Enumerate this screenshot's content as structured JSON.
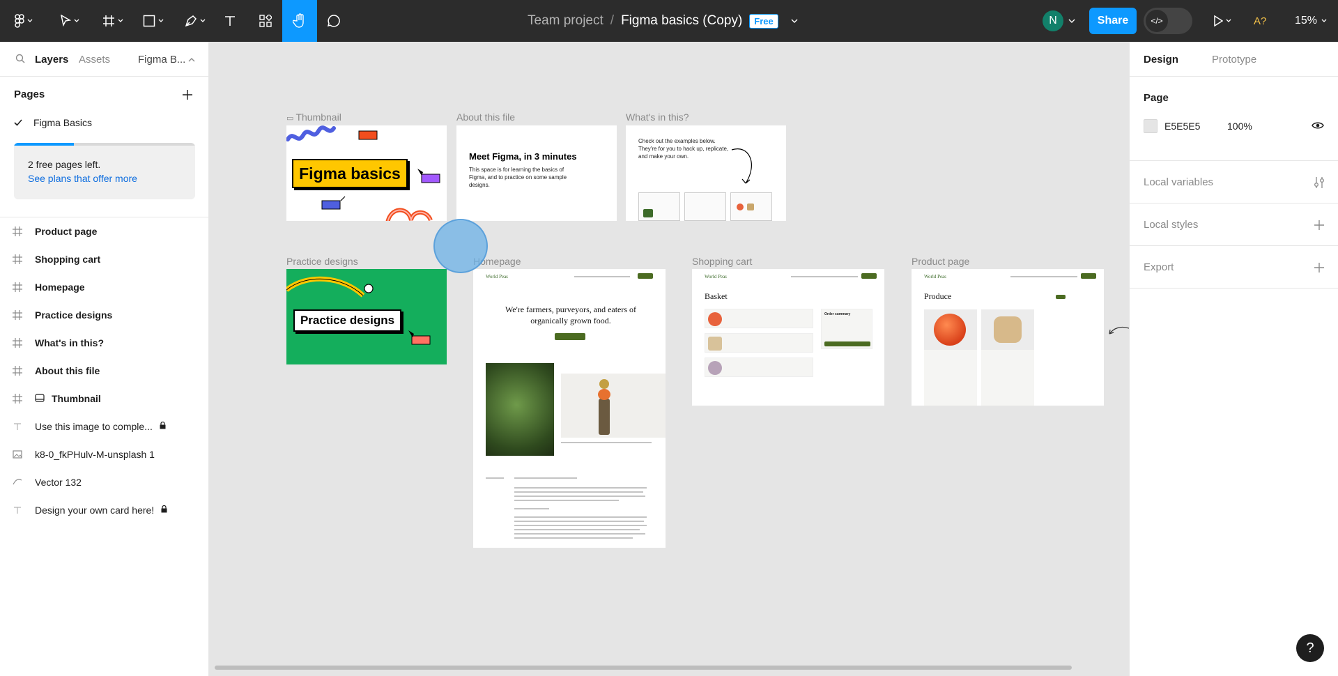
{
  "toolbar": {
    "tools": [
      "figma-menu",
      "move-tool",
      "frame-tool",
      "shape-tool",
      "pen-tool",
      "text-tool",
      "resources-tool",
      "hand-tool",
      "comment-tool"
    ],
    "breadcrumb_team": "Team project",
    "breadcrumb_sep": "/",
    "file_name": "Figma basics (Copy)",
    "plan_badge": "Free",
    "avatar_initial": "N",
    "share_label": "Share",
    "dev_mode_icon": "</>",
    "a_label": "A?",
    "zoom": "15%",
    "colors": {
      "bar": "#2c2c2c",
      "accent": "#0d99ff"
    }
  },
  "left_panel": {
    "tabs": {
      "layers": "Layers",
      "assets": "Assets",
      "file": "Figma B..."
    },
    "pages_header": "Pages",
    "current_page": "Figma Basics",
    "notice": {
      "text": "2 free pages left.",
      "link": "See plans that offer more",
      "progress": 0.33
    },
    "layers": [
      {
        "name": "Product page",
        "icon": "frame-icon"
      },
      {
        "name": "Shopping cart",
        "icon": "frame-icon"
      },
      {
        "name": "Homepage",
        "icon": "frame-icon"
      },
      {
        "name": "Practice designs",
        "icon": "frame-icon"
      },
      {
        "name": "What's in this?",
        "icon": "frame-icon"
      },
      {
        "name": "About this file",
        "icon": "frame-icon"
      },
      {
        "name": "Thumbnail",
        "icon": "frame-icon"
      },
      {
        "name": "Use this image to comple...",
        "icon": "text-icon"
      },
      {
        "name": "k8-0_fkPHulv-M-unsplash 1",
        "icon": "image-icon"
      },
      {
        "name": "Vector 132",
        "icon": "vector-icon"
      },
      {
        "name": "Design your own card here!",
        "icon": "text-icon"
      }
    ]
  },
  "canvas": {
    "frames": {
      "thumbnail": {
        "label": "Thumbnail",
        "title": "Figma basics"
      },
      "about": {
        "label": "About this file",
        "title": "Meet Figma, in 3 minutes",
        "body": "This space is for learning the basics of Figma, and to practice on some sample designs."
      },
      "whats": {
        "label": "What's in this?",
        "body": "Check out the examples below. They're for you to hack up, replicate, and make your own."
      },
      "practice": {
        "label": "Practice designs",
        "title": "Practice designs"
      },
      "homepage": {
        "label": "Homepage",
        "brand": "World Peas",
        "headline": "We're farmers, purveyors, and eaters of organically grown food."
      },
      "cart": {
        "label": "Shopping cart",
        "brand": "World Peas",
        "title": "Basket",
        "summary": "Order summary"
      },
      "product": {
        "label": "Product page",
        "brand": "World Peas",
        "title": "Produce"
      }
    }
  },
  "right_panel": {
    "tabs": {
      "design": "Design",
      "prototype": "Prototype"
    },
    "page_section": "Page",
    "page_color": "E5E5E5",
    "page_opacity": "100%",
    "local_variables": "Local variables",
    "local_styles": "Local styles",
    "export": "Export"
  },
  "help": "?"
}
